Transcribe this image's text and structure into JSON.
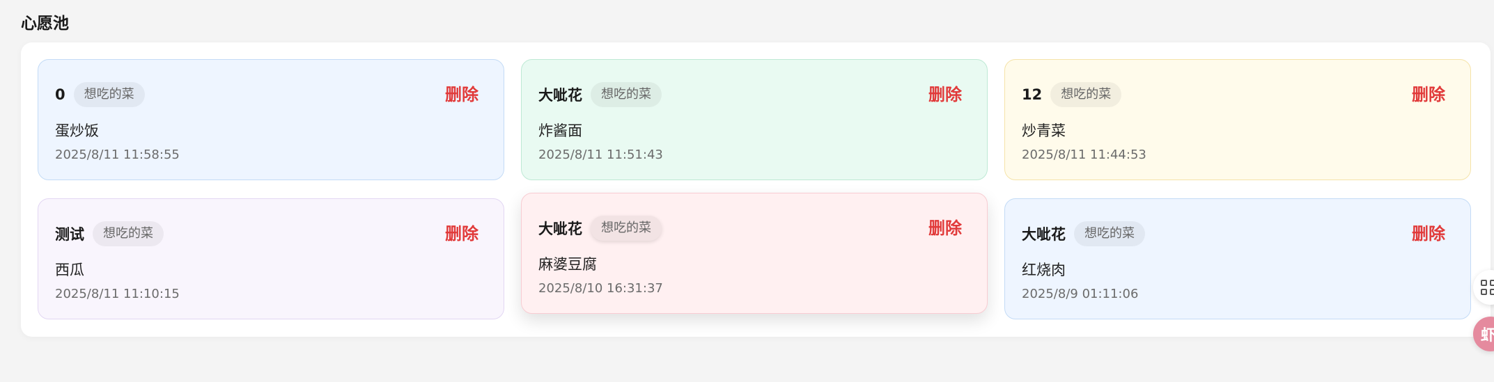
{
  "section": {
    "title": "心愿池"
  },
  "cards": [
    {
      "user": "0",
      "tag": "想吃的菜",
      "delete_label": "删除",
      "dish": "蛋炒饭",
      "time": "2025/8/11 11:58:55",
      "bg": "#eef5ff",
      "border": "#c3dbf6"
    },
    {
      "user": "大呲花",
      "tag": "想吃的菜",
      "delete_label": "删除",
      "dish": "炸酱面",
      "time": "2025/8/11 11:51:43",
      "bg": "#e9faf2",
      "border": "#bde9d4"
    },
    {
      "user": "12",
      "tag": "想吃的菜",
      "delete_label": "删除",
      "dish": "炒青菜",
      "time": "2025/8/11 11:44:53",
      "bg": "#fffbeb",
      "border": "#f5e3a8"
    },
    {
      "user": "测试",
      "tag": "想吃的菜",
      "delete_label": "删除",
      "dish": "西瓜",
      "time": "2025/8/11 11:10:15",
      "bg": "#f9f5fd",
      "border": "#e2d6f3"
    },
    {
      "user": "大呲花",
      "tag": "想吃的菜",
      "delete_label": "删除",
      "dish": "麻婆豆腐",
      "time": "2025/8/10 16:31:37",
      "bg": "#fff0f1",
      "border": "#f8ccd2"
    },
    {
      "user": "大呲花",
      "tag": "想吃的菜",
      "delete_label": "删除",
      "dish": "红烧肉",
      "time": "2025/8/9 01:11:06",
      "bg": "#eef5ff",
      "border": "#c3dbf6"
    }
  ],
  "floating": {
    "grid_icon": "grid-icon",
    "avatar_icon": "avatar-icon",
    "avatar_text": "虾",
    "avatar_color": "#e58a9e"
  }
}
